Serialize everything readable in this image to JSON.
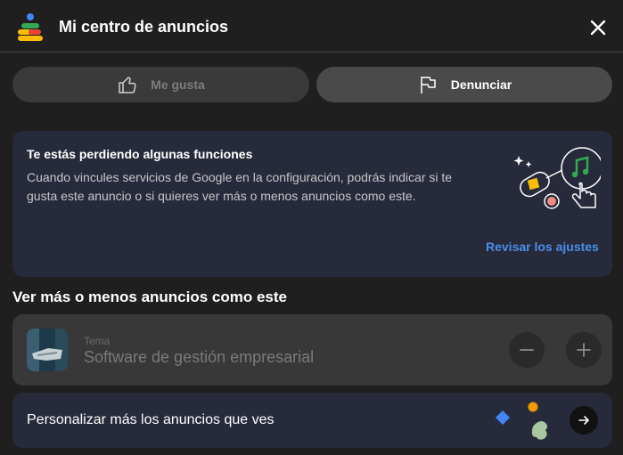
{
  "header": {
    "title": "Mi centro de anuncios",
    "logo_icon": "ads-center-logo-icon",
    "close_icon": "close-icon"
  },
  "actions": {
    "like_label": "Me gusta",
    "like_icon": "thumbs-up-icon",
    "report_label": "Denunciar",
    "report_icon": "flag-icon"
  },
  "info_card": {
    "title": "Te estás perdiendo algunas funciones",
    "body": "Cuando vincules servicios de Google en la configuración, podrás indicar si te gusta este anuncio o si quieres ver más o menos anuncios como este.",
    "link": "Revisar los ajustes"
  },
  "section": {
    "title": "Ver más o menos anuncios como este"
  },
  "topic": {
    "label": "Tema",
    "name": "Software de gestión empresarial",
    "minus_icon": "minus-icon",
    "plus_icon": "plus-icon"
  },
  "customize": {
    "label": "Personalizar más los anuncios que ves",
    "arrow_icon": "arrow-right-icon"
  },
  "colors": {
    "background": "#1f1f1f",
    "card_blue": "#262a3b",
    "link": "#4a8fe8",
    "button_active": "#4a4a4a",
    "button_disabled": "#3a3a3a"
  }
}
